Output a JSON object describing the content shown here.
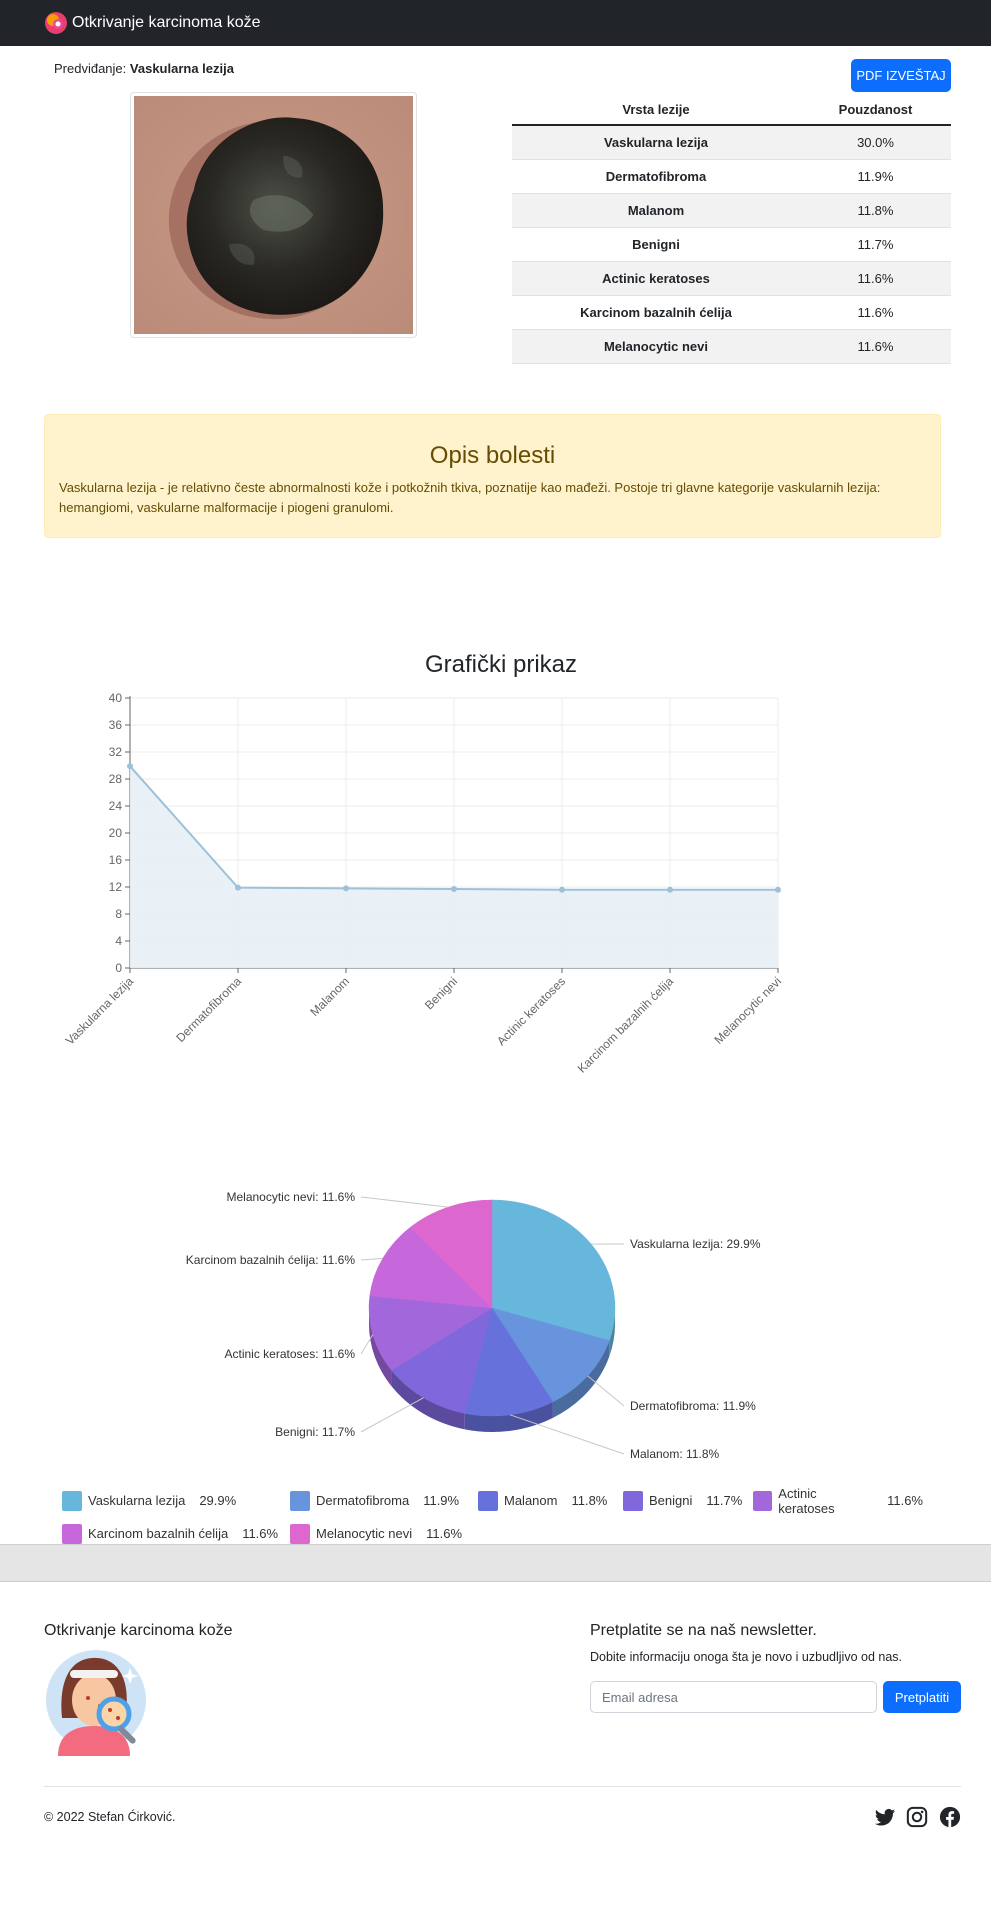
{
  "navbar": {
    "brand": "Otkrivanje karcinoma kože"
  },
  "prediction": {
    "label": "Predviđanje:",
    "value": "Vaskularna lezija"
  },
  "pdf_button": "PDF IZVEŠTAJ",
  "table": {
    "headers": [
      "Vrsta lezije",
      "Pouzdanost"
    ],
    "rows": [
      {
        "label": "Vaskularna lezija",
        "value": "30.0%"
      },
      {
        "label": "Dermatofibroma",
        "value": "11.9%"
      },
      {
        "label": "Malanom",
        "value": "11.8%"
      },
      {
        "label": "Benigni",
        "value": "11.7%"
      },
      {
        "label": "Actinic keratoses",
        "value": "11.6%"
      },
      {
        "label": "Karcinom bazalnih ćelija",
        "value": "11.6%"
      },
      {
        "label": "Melanocytic nevi",
        "value": "11.6%"
      }
    ]
  },
  "alert": {
    "title": "Opis bolesti",
    "text": "Vaskularna lezija - je relativno česte abnormalnosti kože i potkožnih tkiva, poznatije kao mađeži. Postoje tri glavne kategorije vaskularnih lezija: hemangiomi, vaskularne malformacije i piogeni granulomi."
  },
  "chart_heading": "Grafički prikaz",
  "chart_data": [
    {
      "type": "area",
      "title": "",
      "categories": [
        "Vaskularna lezija",
        "Dermatofibroma",
        "Malanom",
        "Benigni",
        "Actinic keratoses",
        "Karcinom bazalnih ćelija",
        "Melanocytic nevi"
      ],
      "values": [
        29.9,
        11.9,
        11.8,
        11.7,
        11.6,
        11.6,
        11.6
      ],
      "ylim": [
        0,
        40
      ],
      "yticks": [
        0,
        4,
        8,
        12,
        16,
        20,
        24,
        28,
        32,
        36,
        40
      ],
      "grid": true,
      "colors": {
        "line": "#9dc1d8",
        "fill": "#e8f0f5"
      }
    },
    {
      "type": "pie",
      "title": "",
      "categories": [
        "Vaskularna lezija",
        "Dermatofibroma",
        "Malanom",
        "Benigni",
        "Actinic keratoses",
        "Karcinom bazalnih ćelija",
        "Melanocytic nevi"
      ],
      "values": [
        29.9,
        11.9,
        11.8,
        11.7,
        11.6,
        11.6,
        11.6
      ],
      "labels": [
        "Vaskularna lezija: 29.9%",
        "Dermatofibroma: 11.9%",
        "Malanom: 11.8%",
        "Benigni: 11.7%",
        "Actinic keratoses: 11.6%",
        "Karcinom bazalnih ćelija: 11.6%",
        "Melanocytic nevi: 11.6%"
      ],
      "legend_values": [
        "29.9%",
        "11.9%",
        "11.8%",
        "11.7%",
        "11.6%",
        "11.6%",
        "11.6%"
      ],
      "colors": [
        "#67b7dc",
        "#6794dc",
        "#6771dc",
        "#8067dc",
        "#a367dc",
        "#c767dc",
        "#dc67ce"
      ],
      "legend": "bottom"
    }
  ],
  "footer": {
    "title": "Otkrivanje karcinoma kože",
    "newsletter_title": "Pretplatite se na naš newsletter.",
    "newsletter_sub": "Dobite informaciju onoga šta je novo i uzbudljivo od nas.",
    "email_placeholder": "Email adresa",
    "subscribe": "Pretplatiti",
    "copyright": "© 2022 Stefan Ćirković."
  }
}
